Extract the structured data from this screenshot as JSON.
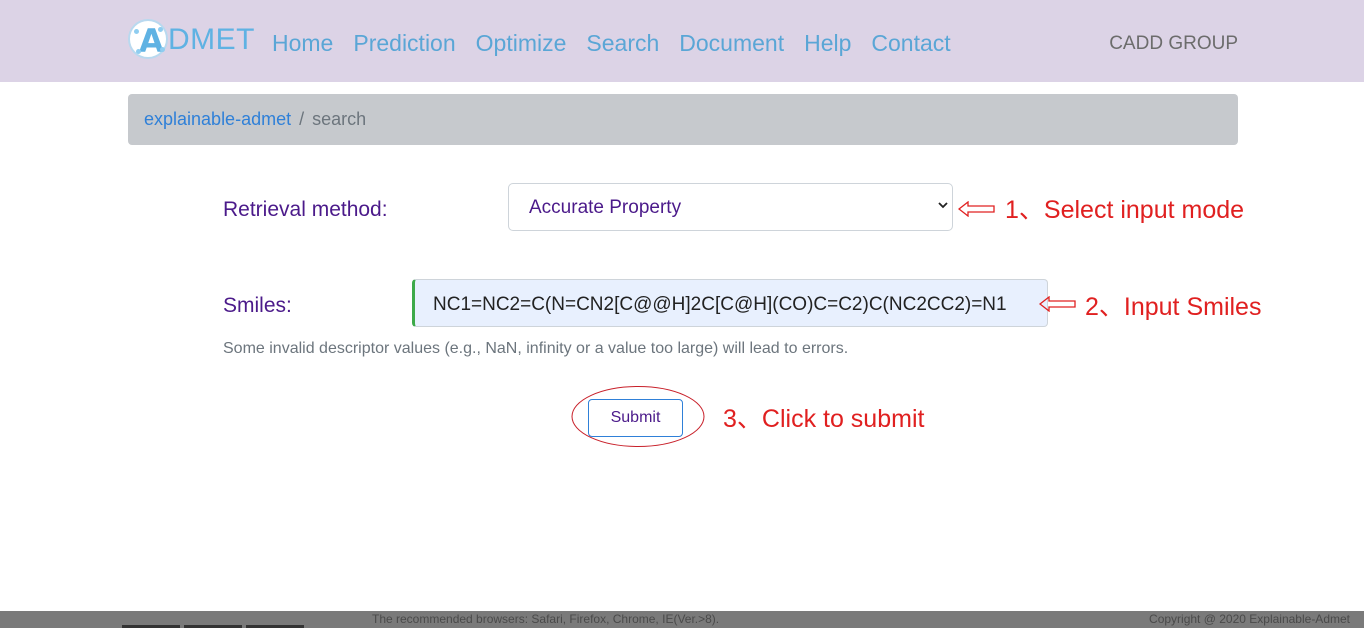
{
  "nav": {
    "logo_letter": "A",
    "logo_text": "DMET",
    "links": [
      "Home",
      "Prediction",
      "Optimize",
      "Search",
      "Document",
      "Help",
      "Contact"
    ],
    "right_label": "CADD GROUP"
  },
  "breadcrumb": {
    "root": "explainable-admet",
    "separator": "/",
    "current": "search"
  },
  "form": {
    "retrieval_label": "Retrieval method:",
    "retrieval_value": "Accurate Property",
    "smiles_label": "Smiles:",
    "smiles_value": "NC1=NC2=C(N=CN2[C@@H]2C[C@H](CO)C=C2)C(NC2CC2)=N1",
    "hint": "Some invalid descriptor values (e.g., NaN, infinity or a value too large) will lead to errors.",
    "submit_label": "Submit"
  },
  "annotations": {
    "step1": "1、Select input mode",
    "step2": "2、Input Smiles",
    "step3": "3、Click to submit",
    "color": "#e02020"
  },
  "footer": {
    "browsers": "The recommended browsers: Safari, Firefox, Chrome, IE(Ver.>8).",
    "copyright": "Copyright @ 2020 Explainable-Admet"
  },
  "colors": {
    "navbar": "#dcd3e6",
    "nav_link": "#5aa6d6",
    "label": "#4b1a8a",
    "breadcrumb_bg": "#c6c9cd",
    "input_bg": "#e8f0fe",
    "valid_border": "#3daa4a"
  }
}
